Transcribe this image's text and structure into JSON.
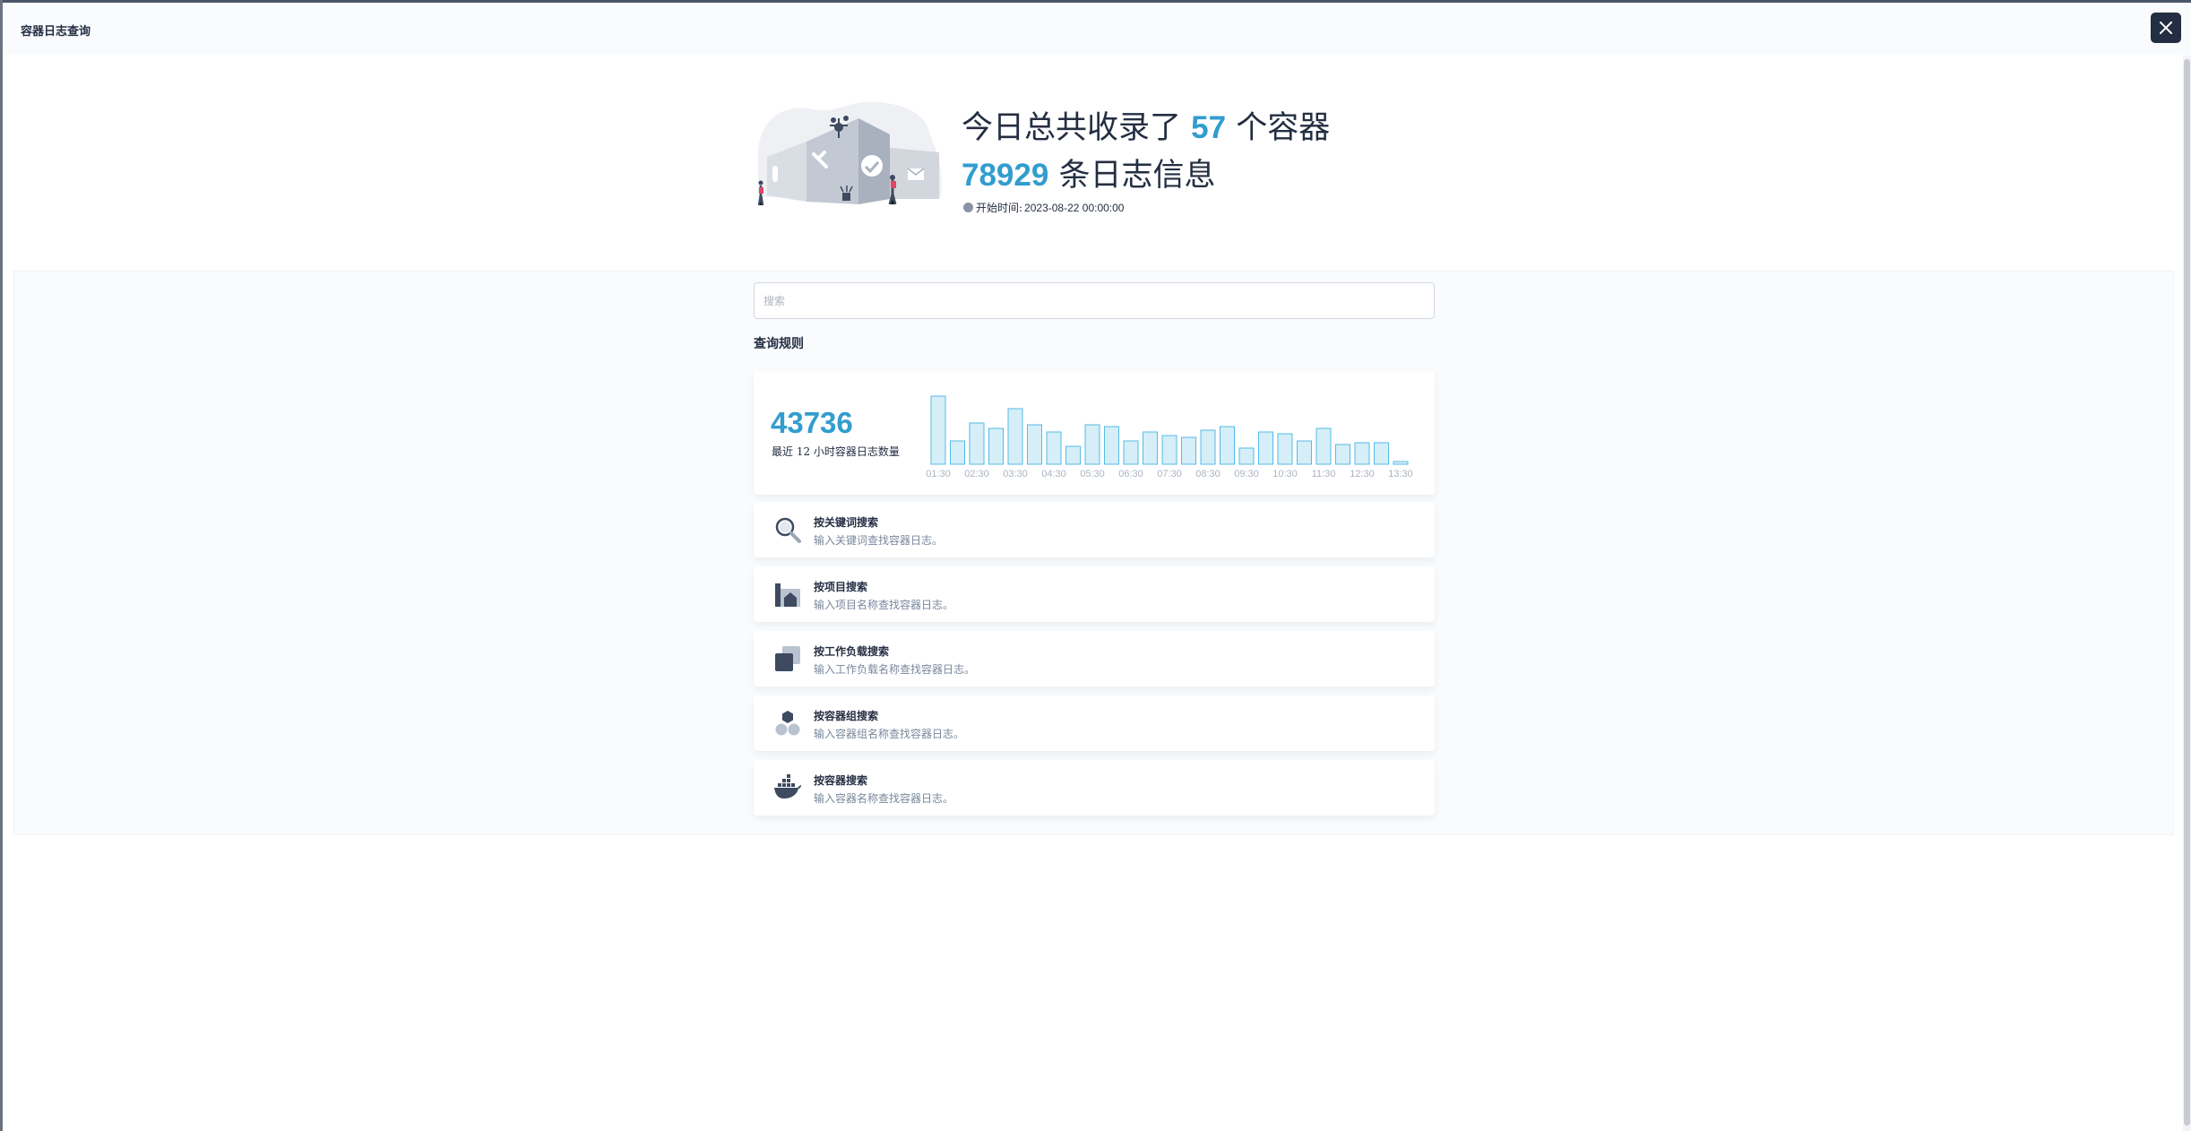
{
  "window": {
    "title": "容器日志查询"
  },
  "summary": {
    "line1_prefix": "今日总共收录了",
    "container_count": "57",
    "line1_suffix": "个容器",
    "log_count": "78929",
    "line2_suffix": "条日志信息",
    "start_label": "开始时间:",
    "start_value": "2023-08-22 00:00:00"
  },
  "search": {
    "placeholder": "搜索"
  },
  "rules": {
    "title": "查询规则",
    "items": [
      {
        "icon": "magnifier-icon",
        "title": "按关键词搜索",
        "desc": "输入关键词查找容器日志。"
      },
      {
        "icon": "project-icon",
        "title": "按项目搜索",
        "desc": "输入项目名称查找容器日志。"
      },
      {
        "icon": "workload-icon",
        "title": "按工作负载搜索",
        "desc": "输入工作负载名称查找容器日志。"
      },
      {
        "icon": "pod-icon",
        "title": "按容器组搜索",
        "desc": "输入容器组名称查找容器日志。"
      },
      {
        "icon": "docker-icon",
        "title": "按容器搜索",
        "desc": "输入容器名称查找容器日志。"
      }
    ]
  },
  "stats": {
    "total": "43736",
    "label": "最近 12 小时容器日志数量"
  },
  "chart_data": {
    "type": "bar",
    "tick_labels": [
      "01:30",
      "02:30",
      "03:30",
      "04:30",
      "05:30",
      "06:30",
      "07:30",
      "08:30",
      "09:30",
      "10:30",
      "11:30",
      "12:30",
      "13:30"
    ],
    "values": [
      76,
      26,
      46,
      40,
      62,
      44,
      36,
      20,
      44,
      42,
      26,
      36,
      32,
      30,
      38,
      42,
      18,
      36,
      34,
      26,
      40,
      22,
      24,
      24,
      3
    ],
    "ylim": [
      0,
      80
    ],
    "colors": {
      "bar_fill": "#d6eef8",
      "bar_stroke": "#55bbe6",
      "accent": "#329dce"
    }
  }
}
